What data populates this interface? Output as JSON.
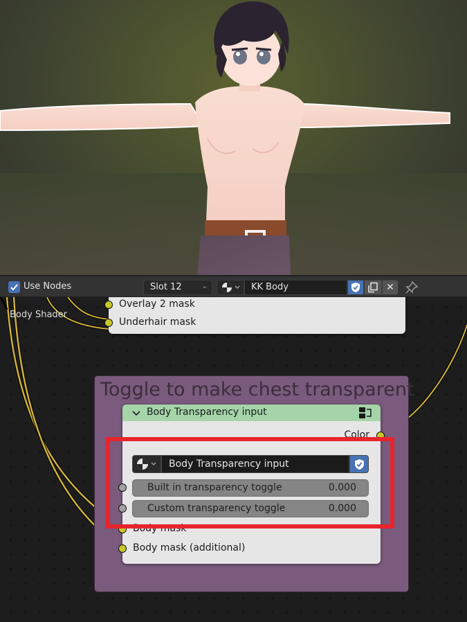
{
  "header": {
    "use_nodes_label": "Use Nodes",
    "use_nodes_checked": true,
    "slot_label": "Slot 12",
    "material_name": "KK Body"
  },
  "editor": {
    "top_node_sockets": [
      "Overlay 2 mask",
      "Underhair mask"
    ],
    "side_label": "Body Shader",
    "frame": {
      "label": "Toggle to make chest transparent",
      "color": "#7a5a7d"
    },
    "group_node": {
      "title": "Body Transparency input",
      "header_color": "#a5d4a9",
      "output_socket": "Color",
      "node_group_name": "Body Transparency input",
      "inputs": [
        {
          "label": "Built in transparency toggle",
          "value": "0.000"
        },
        {
          "label": "Custom transparency toggle",
          "value": "0.000"
        }
      ],
      "extra_inputs": [
        "Body mask",
        "Body mask (additional)"
      ]
    },
    "highlight_color": "#e8242c",
    "wire_color": "#d0b13d"
  }
}
